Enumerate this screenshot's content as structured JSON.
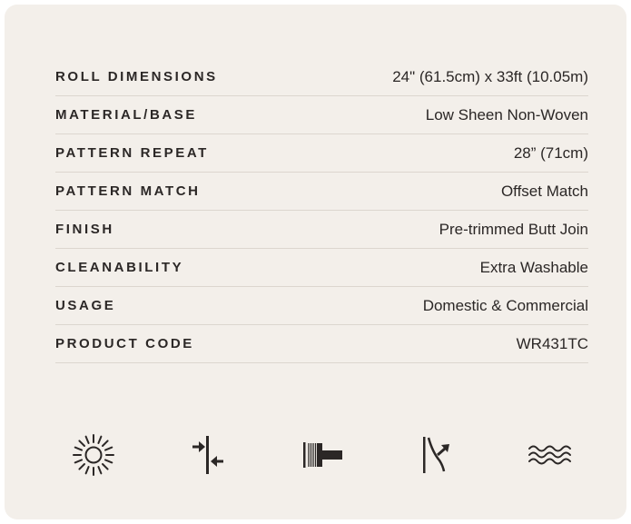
{
  "specs": [
    {
      "label": "ROLL DIMENSIONS",
      "value": "24\" (61.5cm) x 33ft (10.05m)"
    },
    {
      "label": "MATERIAL/BASE",
      "value": "Low Sheen Non-Woven"
    },
    {
      "label": "PATTERN REPEAT",
      "value": "28” (71cm)"
    },
    {
      "label": "PATTERN MATCH",
      "value": "Offset Match"
    },
    {
      "label": "FINISH",
      "value": "Pre-trimmed Butt Join"
    },
    {
      "label": "CLEANABILITY",
      "value": "Extra Washable"
    },
    {
      "label": "USAGE",
      "value": "Domestic & Commercial"
    },
    {
      "label": "PRODUCT CODE",
      "value": "WR431TC"
    }
  ],
  "icons": [
    {
      "name": "light-fastness-sun-icon"
    },
    {
      "name": "butt-join-arrows-icon"
    },
    {
      "name": "paste-the-wall-brush-icon"
    },
    {
      "name": "peelable-strip-icon"
    },
    {
      "name": "extra-washable-waves-icon"
    }
  ],
  "colors": {
    "card_background": "#f3efea",
    "text": "#2b2726",
    "divider": "#dcd6cf"
  }
}
